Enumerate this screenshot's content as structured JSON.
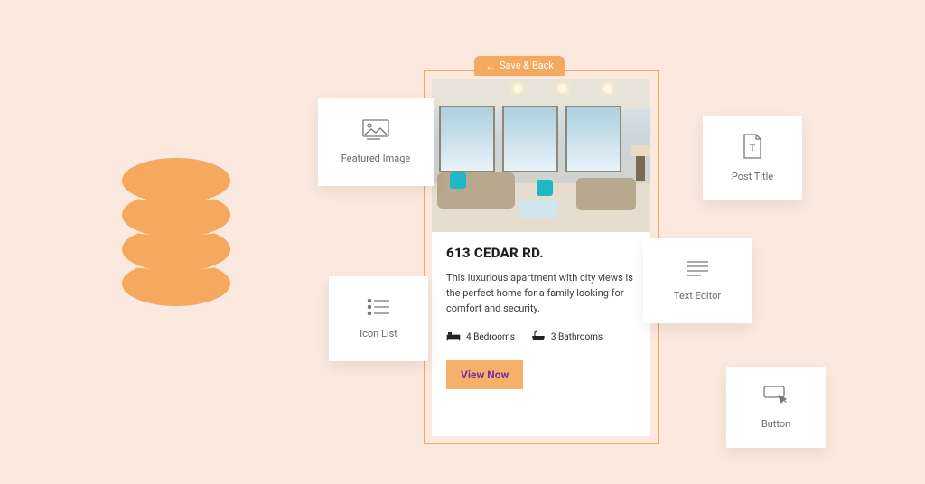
{
  "save_back_label": "Save & Back",
  "listing": {
    "title": "613 CEDAR RD.",
    "description": "This luxurious apartment with city views is the perfect home for a family looking for comfort and security.",
    "bedrooms_label": "4 Bedrooms",
    "bathrooms_label": "3 Bathrooms",
    "cta_label": "View Now"
  },
  "tiles": {
    "featured_image": "Featured Image",
    "icon_list": "Icon List",
    "post_title": "Post Title",
    "text_editor": "Text Editor",
    "button": "Button"
  }
}
